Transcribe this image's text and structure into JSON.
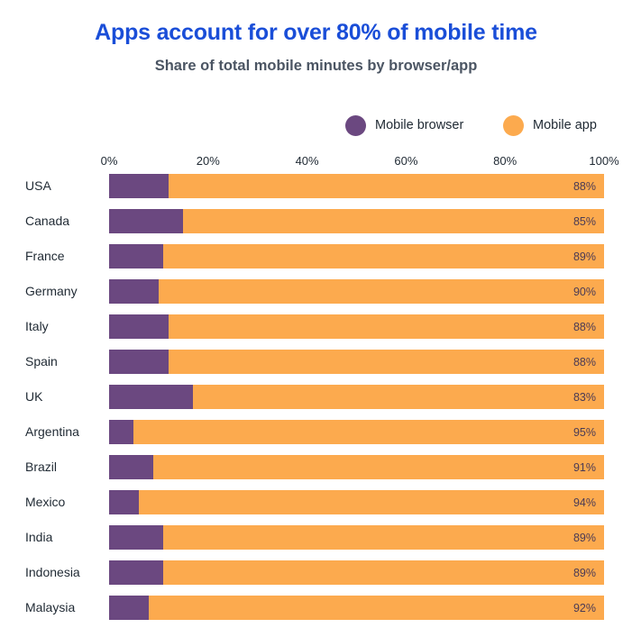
{
  "header": {
    "title": "Apps account for over 80% of mobile time",
    "subtitle": "Share of total mobile minutes by browser/app"
  },
  "legend": {
    "items": [
      {
        "label": "Mobile browser",
        "color": "#6b4880",
        "icon": "legend-dot-icon"
      },
      {
        "label": "Mobile app",
        "color": "#fcaa4e",
        "icon": "legend-dot-icon"
      }
    ]
  },
  "colors": {
    "title": "#1a4ed8",
    "subtitle": "#4b5563",
    "browser": "#6b4880",
    "app": "#fcaa4e",
    "value_label": "#4a3a55",
    "background": "#ffffff"
  },
  "chart_data": {
    "type": "bar",
    "orientation": "horizontal",
    "stacked": true,
    "normalized": true,
    "title": "Apps account for over 80% of mobile time",
    "subtitle": "Share of total mobile minutes by browser/app",
    "xlabel": "",
    "ylabel": "",
    "xlim": [
      0,
      100
    ],
    "xticks": [
      0,
      20,
      40,
      60,
      80,
      100
    ],
    "xtick_labels": [
      "0%",
      "20%",
      "40%",
      "60%",
      "80%",
      "100%"
    ],
    "grid": false,
    "legend_position": "top-right",
    "value_label_series": "Mobile app",
    "value_label_suffix": "%",
    "categories": [
      "USA",
      "Canada",
      "France",
      "Germany",
      "Italy",
      "Spain",
      "UK",
      "Argentina",
      "Brazil",
      "Mexico",
      "India",
      "Indonesia",
      "Malaysia"
    ],
    "series": [
      {
        "name": "Mobile browser",
        "color": "#6b4880",
        "values": [
          12,
          15,
          11,
          10,
          12,
          12,
          17,
          5,
          9,
          6,
          11,
          11,
          8
        ]
      },
      {
        "name": "Mobile app",
        "color": "#fcaa4e",
        "values": [
          88,
          85,
          89,
          90,
          88,
          88,
          83,
          95,
          91,
          94,
          89,
          89,
          92
        ]
      }
    ],
    "value_labels": [
      "88%",
      "85%",
      "89%",
      "90%",
      "88%",
      "88%",
      "83%",
      "95%",
      "91%",
      "94%",
      "89%",
      "89%",
      "92%"
    ]
  }
}
